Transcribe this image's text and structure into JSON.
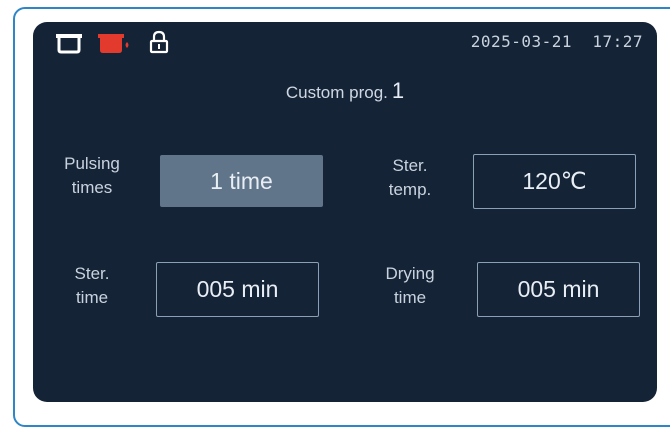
{
  "status_bar": {
    "icons": [
      "chamber-icon",
      "chamber-heating-icon",
      "lock-icon"
    ],
    "date": "2025-03-21",
    "time": "17:27",
    "colors": {
      "icon": "#ffffff",
      "heating": "#e23b2e"
    }
  },
  "program": {
    "title": "Custom prog.",
    "number": "1"
  },
  "params": {
    "pulsing_times": {
      "label_line1": "Pulsing",
      "label_line2": "times",
      "value": "1 time"
    },
    "ster_temp": {
      "label_line1": "Ster.",
      "label_line2": "temp.",
      "value": "120℃"
    },
    "ster_time": {
      "label_line1": "Ster.",
      "label_line2": "time",
      "value": "005 min"
    },
    "drying_time": {
      "label_line1": "Drying",
      "label_line2": "time",
      "value": "005 min"
    }
  },
  "colors": {
    "screen_bg": "#152337",
    "frame": "#2f86c6",
    "active_field": "#60748a"
  }
}
